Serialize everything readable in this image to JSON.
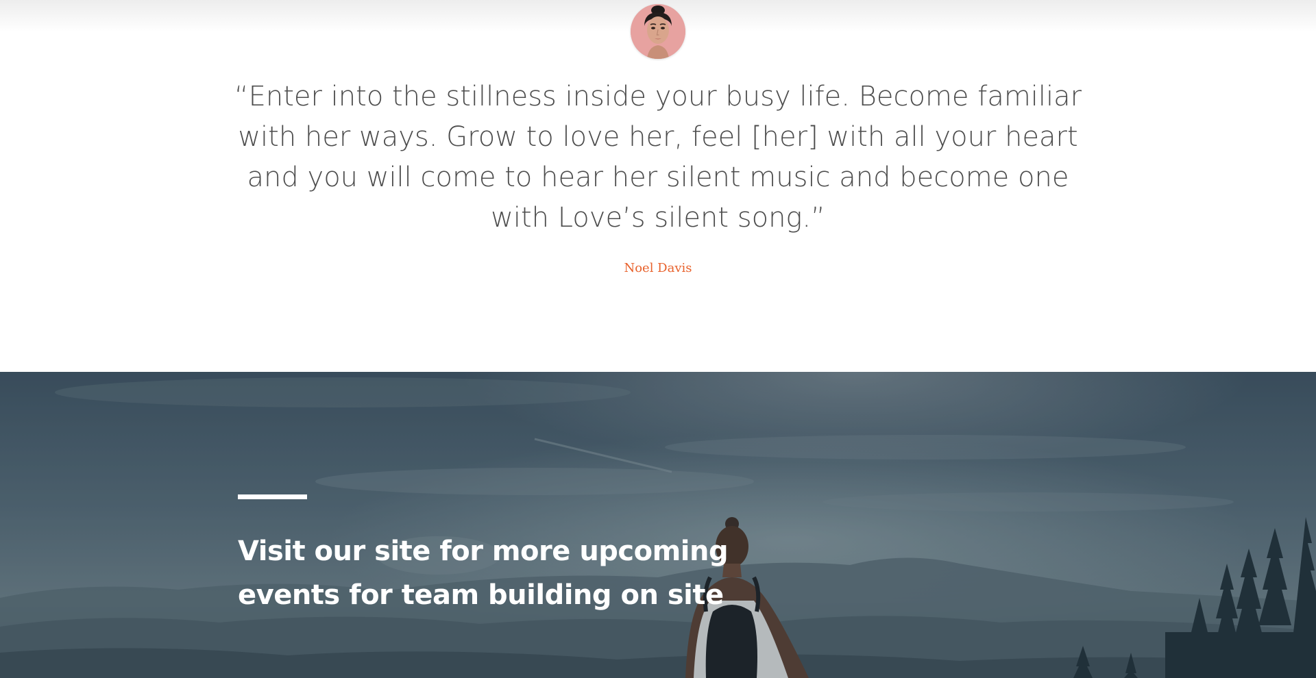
{
  "testimonial": {
    "avatar_icon": "portrait-avatar",
    "quote": "“Enter into the stillness inside your busy life. Become familiar with her ways. Grow to love her, feel [her] with all your heart and you will come to hear her silent music and become one with Love’s silent song.”",
    "author": "Noel Davis",
    "author_color": "#e8612b"
  },
  "banner": {
    "heading_line1": "Visit our site for more upcoming",
    "heading_line2": "events for team building on site",
    "background_image": "hiker-mountain-landscape"
  }
}
